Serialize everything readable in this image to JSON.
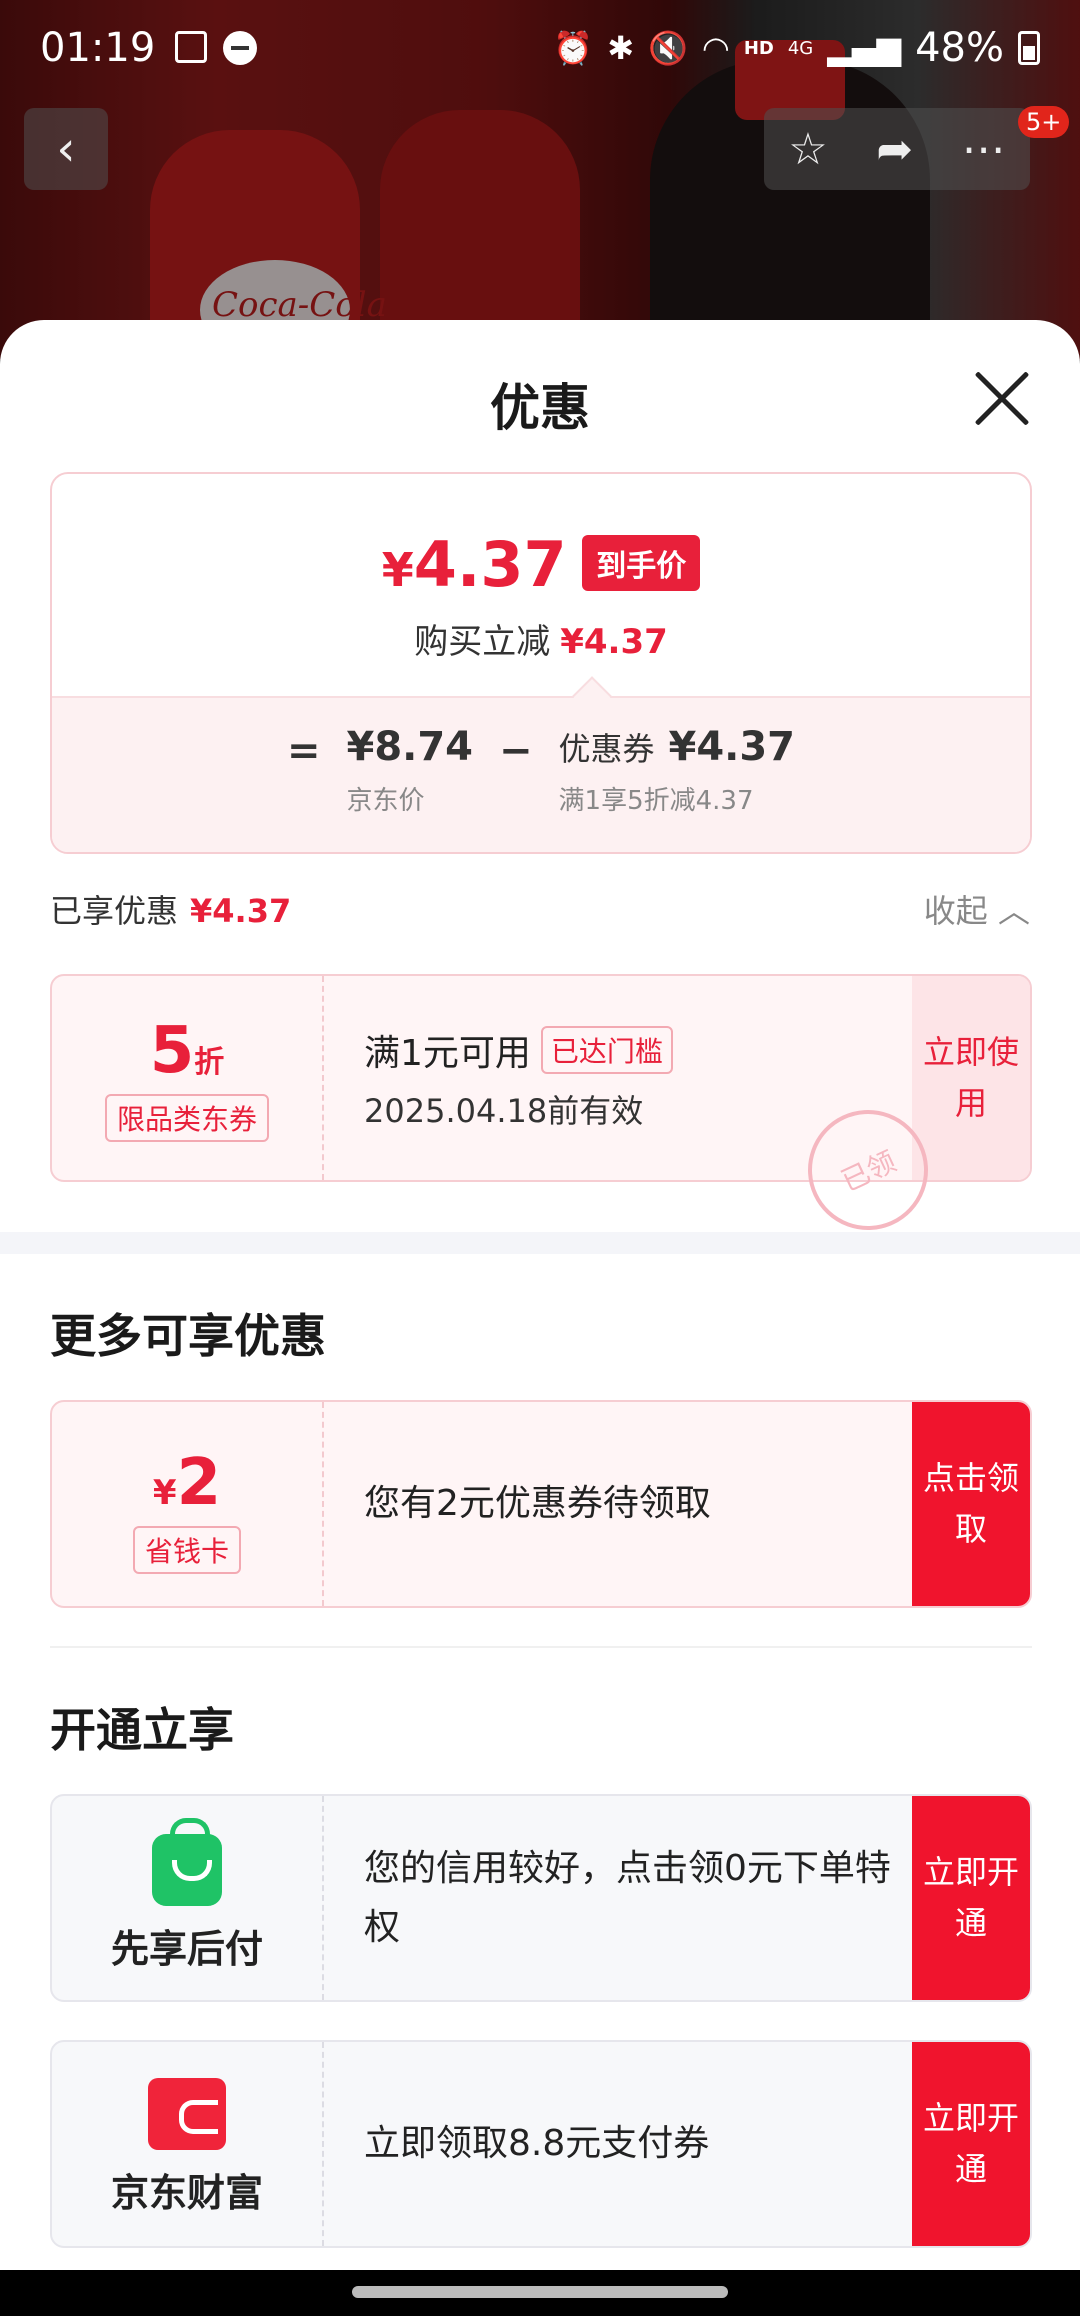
{
  "status_bar": {
    "time": "01:19",
    "network": "4G",
    "hd": "HD",
    "battery": "48%"
  },
  "product_image": {
    "brand_text": "Coca-Cola"
  },
  "nav": {
    "badge": "5+"
  },
  "sheet": {
    "title": "优惠",
    "price": {
      "yen": "¥",
      "amount": "4.37",
      "tag": "到手价",
      "sub_label": "购买立减",
      "sub_value": "¥4.37"
    },
    "formula": {
      "equals": "=",
      "minus": "−",
      "jd_price": "¥8.74",
      "jd_price_label": "京东价",
      "coupon_label": "优惠券",
      "coupon_value": "¥4.37",
      "coupon_rule": "满1享5折减4.37"
    },
    "enjoyed": {
      "label": "已享优惠",
      "value": "¥4.37",
      "collapse": "收起"
    },
    "coupon1": {
      "value": "5",
      "unit": "折",
      "tag": "限品类东券",
      "condition": "满1元可用",
      "reached": "已达门槛",
      "validity": "2025.04.18前有效",
      "stamp": "已领",
      "action": "立即使用"
    },
    "more": {
      "title": "更多可享优惠",
      "card": {
        "yen": "¥",
        "value": "2",
        "tag": "省钱卡",
        "text": "您有2元优惠券待领取",
        "action": "点击领取"
      }
    },
    "open": {
      "title": "开通立享",
      "items": [
        {
          "name": "先享后付",
          "icon": "shopping-bag-icon",
          "text": "您的信用较好，点击领0元下单特权",
          "action": "立即开通"
        },
        {
          "name": "京东财富",
          "icon": "wallet-icon",
          "text": "立即领取8.8元支付券",
          "action": "立即开通"
        }
      ]
    }
  }
}
